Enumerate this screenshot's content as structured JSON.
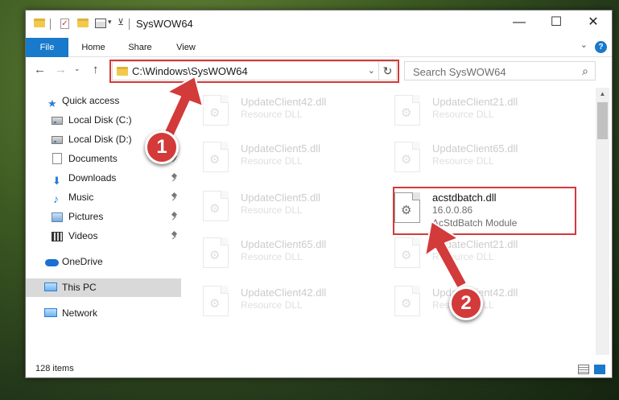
{
  "window": {
    "title": "SysWOW64",
    "controls": {
      "minimize": "—",
      "maximize": "☐",
      "close": "✕"
    }
  },
  "ribbon": {
    "tabs": [
      {
        "label": "File"
      },
      {
        "label": "Home"
      },
      {
        "label": "Share"
      },
      {
        "label": "View"
      }
    ],
    "help": "?"
  },
  "address": {
    "path": "C:\\Windows\\SysWOW64",
    "search_placeholder": "Search SysWOW64"
  },
  "nav": {
    "items": [
      {
        "label": "Quick access",
        "icon": "star-icon",
        "pinned": false
      },
      {
        "label": "Local Disk (C:)",
        "icon": "disk-icon",
        "pinned": false
      },
      {
        "label": "Local Disk (D:)",
        "icon": "disk-icon",
        "pinned": false
      },
      {
        "label": "Documents",
        "icon": "documents-icon",
        "pinned": true
      },
      {
        "label": "Downloads",
        "icon": "download-icon",
        "pinned": true
      },
      {
        "label": "Music",
        "icon": "music-icon",
        "pinned": true
      },
      {
        "label": "Pictures",
        "icon": "pictures-icon",
        "pinned": true
      },
      {
        "label": "Videos",
        "icon": "videos-icon",
        "pinned": true
      },
      {
        "label": "OneDrive",
        "icon": "onedrive-icon",
        "pinned": false
      },
      {
        "label": "This PC",
        "icon": "this-pc-icon",
        "pinned": false,
        "selected": true
      },
      {
        "label": "Network",
        "icon": "network-icon",
        "pinned": false
      }
    ]
  },
  "files": {
    "left": [
      {
        "name": "UpdateClient42.dll",
        "type": "Resource DLL"
      },
      {
        "name": "UpdateClient5.dll",
        "type": "Resource DLL"
      },
      {
        "name": "UpdateClient5.dll",
        "type": "Resource DLL"
      },
      {
        "name": "UpdateClient65.dll",
        "type": "Resource DLL"
      },
      {
        "name": "UpdateClient42.dll",
        "type": "Resource DLL"
      }
    ],
    "right": [
      {
        "name": "UpdateClient21.dll",
        "type": "Resource DLL"
      },
      {
        "name": "UpdateClient65.dll",
        "type": "Resource DLL"
      },
      {
        "name": "acstdbatch.dll",
        "version": "16.0.0.86",
        "description": "AcStdBatch Module",
        "highlighted": true
      },
      {
        "name": "UpdateClient21.dll",
        "type": "Resource DLL"
      },
      {
        "name": "UpdateClient42.dll",
        "type": "Resource DLL"
      }
    ]
  },
  "status": {
    "item_count": "128 items"
  },
  "annotations": {
    "step1": "1",
    "step2": "2",
    "color": "#d33a3a"
  },
  "colors": {
    "accent": "#1979ca",
    "selection": "#d9d9d9",
    "annotation_red": "#d33a3a"
  }
}
